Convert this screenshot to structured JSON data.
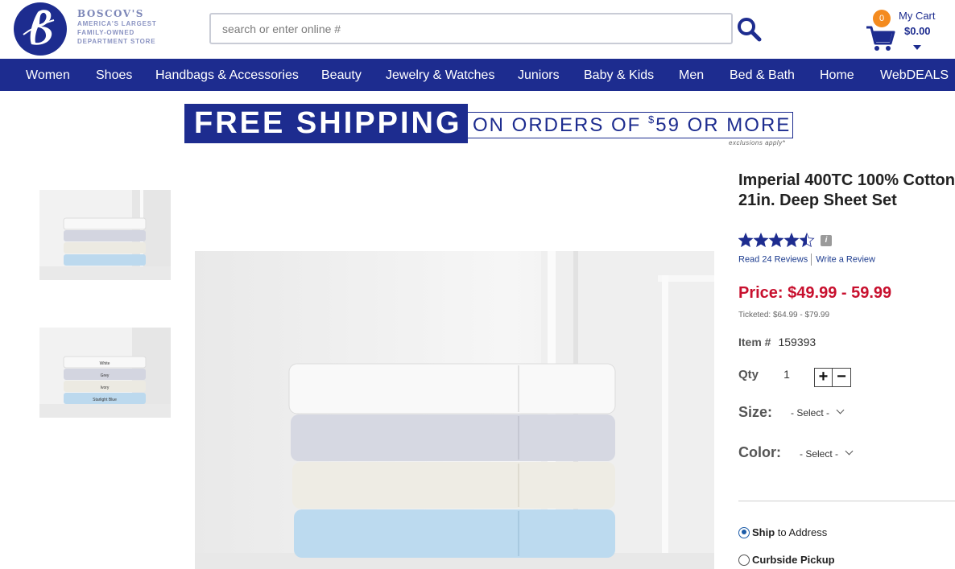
{
  "brand": {
    "name": "BOSCOV'S",
    "tagline": [
      "AMERICA'S LARGEST",
      "FAMILY-OWNED",
      "DEPARTMENT STORE"
    ],
    "color": "#1d2c8f"
  },
  "search": {
    "placeholder": "search or enter online #",
    "icon": "search-icon"
  },
  "cart": {
    "count": "0",
    "label": "My Cart",
    "total": "$0.00",
    "icon": "shopping-cart-icon"
  },
  "nav": {
    "items": [
      "Women",
      "Shoes",
      "Handbags & Accessories",
      "Beauty",
      "Jewelry & Watches",
      "Juniors",
      "Baby & Kids",
      "Men",
      "Bed & Bath",
      "Home",
      "WebDEALS"
    ]
  },
  "banner": {
    "headline": "FREE SHIPPING",
    "offer_prefix": "ON ORDERS OF ",
    "offer_dollar": "$",
    "offer_amount": "59 OR MORE",
    "note": "exclusions apply*"
  },
  "thumbnails": {
    "second_labels": [
      "White",
      "Grey",
      "Ivory",
      "Starlight Blue"
    ]
  },
  "product": {
    "title": "Imperial 400TC 100% Cotton 21in. Deep Sheet Set",
    "rating": 4.5,
    "rating_max": 5,
    "info_icon": "i",
    "read_reviews": "Read 24 Reviews",
    "write_review": "Write a Review",
    "price": "Price: $49.99 - 59.99",
    "ticketed": "Ticketed: $64.99 - $79.99",
    "item_label": "Item #",
    "item_number": "159393",
    "qty_label": "Qty",
    "qty_value": "1",
    "qty_plus": "+",
    "qty_minus": "−",
    "size_label": "Size:",
    "size_value": "- Select -",
    "color_label": "Color:",
    "color_value": "- Select -",
    "ship_bold": "Ship",
    "ship_rest": " to Address",
    "pickup": "Curbside Pickup",
    "price_color": "#c8102e"
  }
}
